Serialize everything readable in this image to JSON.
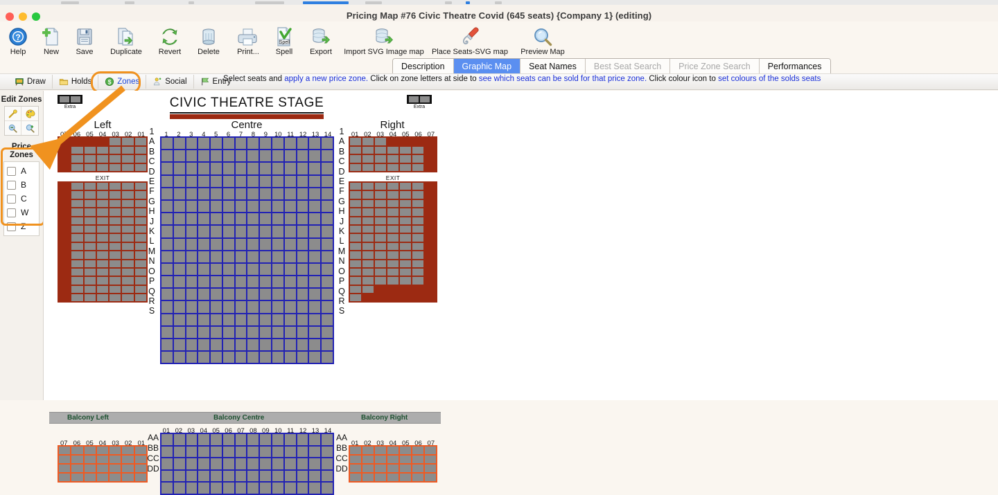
{
  "window": {
    "title": "Pricing Map #76 Civic Theatre Covid (645 seats) {Company 1} (editing)"
  },
  "toolbar": {
    "items": [
      {
        "label": "Help",
        "icon": "help-icon"
      },
      {
        "label": "New",
        "icon": "new-document-icon"
      },
      {
        "label": "Save",
        "icon": "save-disk-icon"
      },
      {
        "label": "Duplicate",
        "icon": "duplicate-icon"
      },
      {
        "label": "Revert",
        "icon": "revert-refresh-icon"
      },
      {
        "label": "Delete",
        "icon": "trash-icon"
      },
      {
        "label": "Print...",
        "icon": "printer-icon"
      },
      {
        "label": "Spell",
        "icon": "spellcheck-icon"
      },
      {
        "label": "Export",
        "icon": "export-database-icon"
      },
      {
        "label": "Import SVG Image map",
        "icon": "import-database-icon"
      },
      {
        "label": "Place Seats-SVG map",
        "icon": "screwdriver-icon"
      },
      {
        "label": "Preview Map",
        "icon": "magnifier-preview-icon"
      }
    ]
  },
  "tabs": [
    {
      "label": "Description",
      "state": "normal"
    },
    {
      "label": "Graphic Map",
      "state": "selected"
    },
    {
      "label": "Seat Names",
      "state": "normal"
    },
    {
      "label": "Best Seat Search",
      "state": "disabled"
    },
    {
      "label": "Price Zone Search",
      "state": "disabled"
    },
    {
      "label": "Performances",
      "state": "normal"
    }
  ],
  "modes": [
    {
      "label": "Draw",
      "icon": "draw-easel-icon",
      "active": false
    },
    {
      "label": "Holds",
      "icon": "holds-folder-icon",
      "active": false
    },
    {
      "label": "Zones",
      "icon": "dollar-zones-icon",
      "active": true
    },
    {
      "label": "Social",
      "icon": "social-distance-icon",
      "active": false
    },
    {
      "label": "Entry",
      "icon": "entry-flag-icon",
      "active": false
    }
  ],
  "hint": {
    "part1": "Select seats and ",
    "link1": "apply a new price zone.",
    "part2": "  Click on zone letters at side to ",
    "link2": "see which seats can be sold for that price zone.",
    "part3": "  Click colour icon to ",
    "link3": "set colours of the solds seats"
  },
  "sidebar": {
    "edit_zones_title": "Edit Zones",
    "edit_zone_icons": [
      {
        "name": "magic-wand-icon"
      },
      {
        "name": "color-palette-icon"
      },
      {
        "name": "zoom-out-icon"
      },
      {
        "name": "zoom-in-icon"
      }
    ],
    "price_zones_title": "Price Zones",
    "price_zones": [
      "A",
      "B",
      "C",
      "W",
      "Z"
    ]
  },
  "map": {
    "stage_title": "CIVIC THEATRE STAGE",
    "extra_left_label": "Extra",
    "extra_right_label": "Extra",
    "sections": [
      {
        "name": "Left",
        "columns": [
          "07",
          "06",
          "05",
          "04",
          "03",
          "02",
          "01"
        ]
      },
      {
        "name": "Centre",
        "columns": [
          "1",
          "2",
          "3",
          "4",
          "5",
          "6",
          "7",
          "8",
          "9",
          "10",
          "11",
          "12",
          "13",
          "14"
        ]
      },
      {
        "name": "Right",
        "columns": [
          "01",
          "02",
          "03",
          "04",
          "05",
          "06",
          "07"
        ]
      }
    ],
    "row_letters": [
      "1",
      "A",
      "B",
      "C",
      "D",
      "E",
      "F",
      "G",
      "H",
      "J",
      "K",
      "L",
      "M",
      "N",
      "O",
      "P",
      "Q",
      "R",
      "S"
    ],
    "exit_label": "EXIT",
    "balcony_labels": [
      "Balcony Left",
      "Balcony Centre",
      "Balcony Right"
    ],
    "balcony_rows": [
      "AA",
      "BB",
      "CC",
      "DD"
    ],
    "balcony_columns_side": [
      "07",
      "06",
      "05",
      "04",
      "03",
      "02",
      "01"
    ],
    "balcony_columns_right": [
      "01",
      "02",
      "03",
      "04",
      "05",
      "06",
      "07"
    ],
    "balcony_columns_centre": [
      "01",
      "02",
      "03",
      "04",
      "05",
      "06",
      "07",
      "08",
      "09",
      "10",
      "11",
      "12",
      "13",
      "14"
    ],
    "colors": {
      "zone_left_right": "#9c2a12",
      "zone_centre": "#2222b4",
      "zone_balcony_side": "#ef5a23",
      "seat": "#8c8c8c",
      "stage_bar": "#9c2a12",
      "balcony_bar": "#adadad",
      "highlight": "#f0921f"
    }
  }
}
